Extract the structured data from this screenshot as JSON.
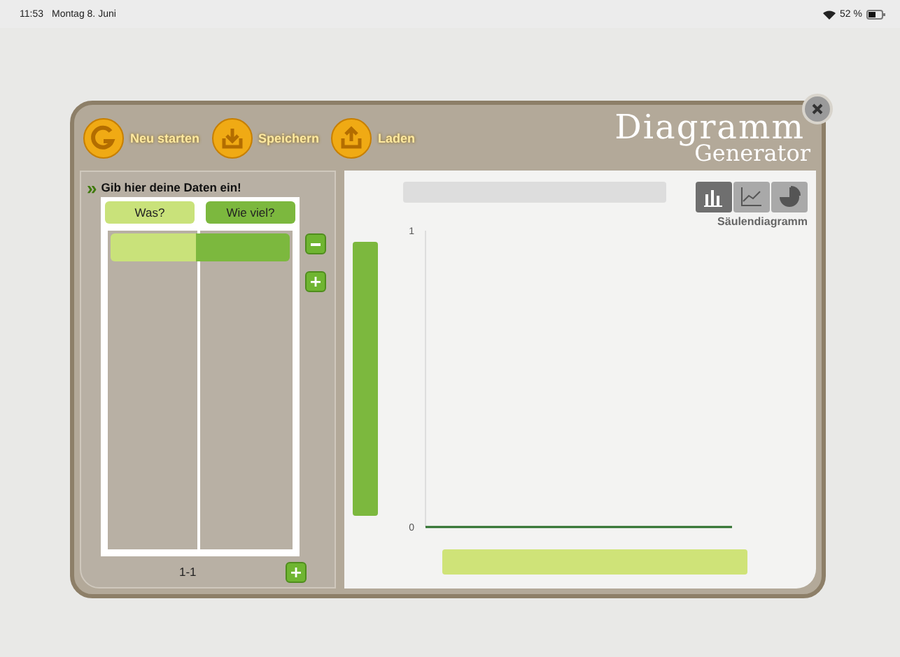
{
  "status_bar": {
    "time": "11:53",
    "date": "Montag 8. Juni",
    "battery": "52 %"
  },
  "toolbar": {
    "buttons": [
      {
        "label": "Neu starten",
        "kind": "restart"
      },
      {
        "label": "Speichern",
        "kind": "save"
      },
      {
        "label": "Laden",
        "kind": "load"
      }
    ]
  },
  "logo": {
    "line_1": "Diagramm",
    "line_2": "Generator"
  },
  "data_panel": {
    "marker": "»",
    "title": "Gib hier deine Daten ein!",
    "columns": [
      "Was?",
      "Wie viel?"
    ],
    "range": "1-1"
  },
  "chart_types": [
    {
      "kind": "bar",
      "selected": true
    },
    {
      "kind": "line",
      "selected": false
    },
    {
      "kind": "pie",
      "selected": false
    }
  ],
  "chart_type_label": "Säulendiagramm",
  "chart": {
    "axis_ticks": [
      "1",
      "0"
    ]
  }
}
